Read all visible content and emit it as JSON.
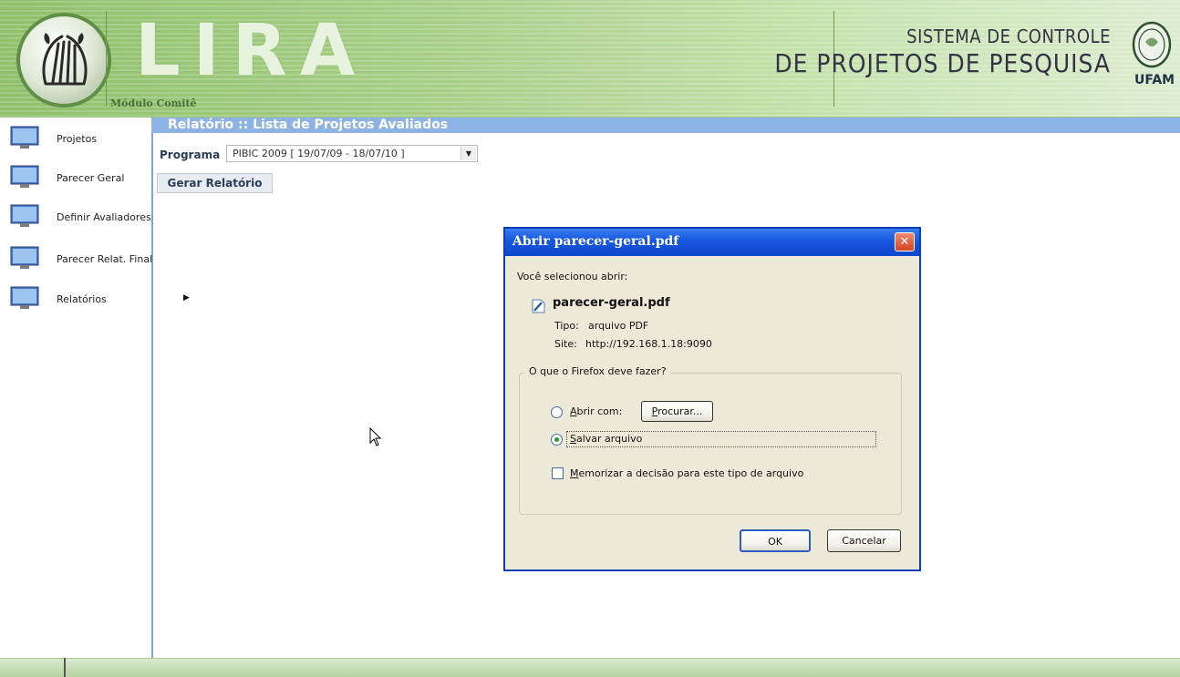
{
  "header": {
    "app_name": "LIRA",
    "module": "Módulo Comitê",
    "system_line1": "SISTEMA DE CONTROLE",
    "system_line2": "DE PROJETOS DE PESQUISA",
    "university": "UFAM",
    "logo_icon": "lyre-logo-icon",
    "seal_icon": "ufam-seal-icon"
  },
  "sidebar": {
    "items": [
      {
        "label": "Projetos",
        "icon": "monitor-icon"
      },
      {
        "label": "Parecer Geral",
        "icon": "monitor-icon"
      },
      {
        "label": "Definir Avaliadores",
        "icon": "monitor-icon"
      },
      {
        "label": "Parecer Relat. Final",
        "icon": "monitor-icon"
      },
      {
        "label": "Relatórios",
        "icon": "monitor-icon"
      }
    ]
  },
  "content": {
    "title": "Relatório :: Lista de Projetos Avaliados",
    "programa_label": "Programa",
    "programa_value": "PIBIC 2009 [ 19/07/09 - 18/07/10 ]",
    "gerar_button": "Gerar Relatório"
  },
  "dialog": {
    "title": "Abrir parecer-geral.pdf",
    "intro": "Você selecionou abrir:",
    "file_name": "parecer-geral.pdf",
    "tipo_label": "Tipo:",
    "tipo_value": "arquivo PDF",
    "site_label": "Site:",
    "site_value": "http://192.168.1.18:9090",
    "group_legend": "O que o Firefox deve fazer?",
    "abrir_com_prefix": "A",
    "abrir_com_rest": "brir com:",
    "procurar_prefix": "P",
    "procurar_rest": "rocurar...",
    "salvar_prefix": "S",
    "salvar_rest": "alvar arquivo",
    "memorizar_prefix": "M",
    "memorizar_rest": "emorizar a decisão para este tipo de arquivo",
    "ok_label": "OK",
    "cancel_label": "Cancelar",
    "selected_option": "salvar",
    "remember_checked": false,
    "titlebar_color": "#0f47cc"
  },
  "colors": {
    "header_green": "#a9d08a",
    "content_title_bar": "#8cb2e6",
    "sidebar_border": "#7ea6d6"
  }
}
